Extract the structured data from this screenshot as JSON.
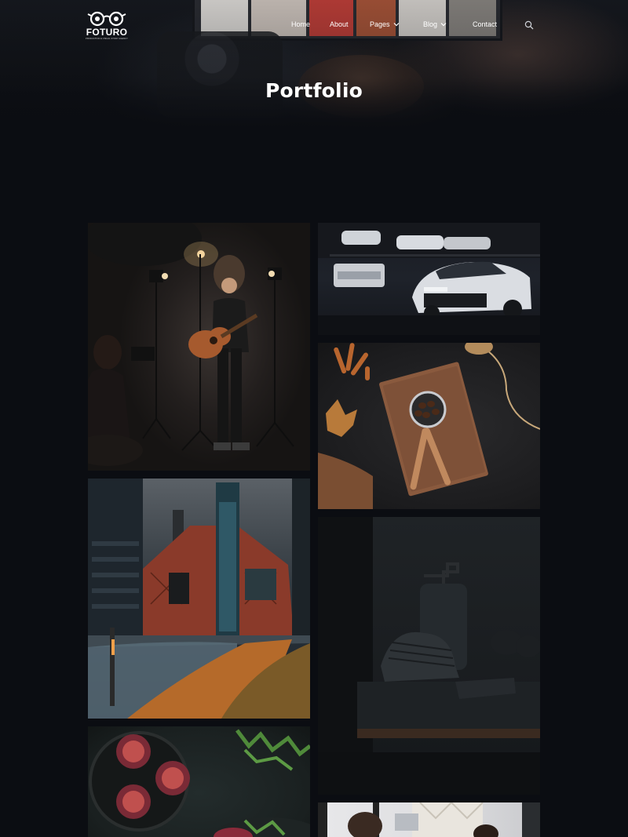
{
  "brand": {
    "name": "FOTURO",
    "tagline": "PRODUCTION & VISUAL STORY AGENCY"
  },
  "nav": {
    "items": [
      {
        "label": "Home",
        "has_dropdown": false
      },
      {
        "label": "About",
        "has_dropdown": false
      },
      {
        "label": "Pages",
        "has_dropdown": true
      },
      {
        "label": "Blog",
        "has_dropdown": true
      },
      {
        "label": "Contact",
        "has_dropdown": false
      }
    ],
    "search_icon": "search-icon"
  },
  "hero": {
    "title": "Portfolio"
  },
  "portfolio": {
    "items": [
      {
        "subject": "musician",
        "column": "left"
      },
      {
        "subject": "cars",
        "column": "right"
      },
      {
        "subject": "coffee",
        "column": "right"
      },
      {
        "subject": "building",
        "column": "left"
      },
      {
        "subject": "product",
        "column": "right"
      },
      {
        "subject": "figs",
        "column": "left"
      },
      {
        "subject": "people",
        "column": "right"
      }
    ]
  },
  "colors": {
    "background": "#0b0d12",
    "text": "#ffffff"
  }
}
